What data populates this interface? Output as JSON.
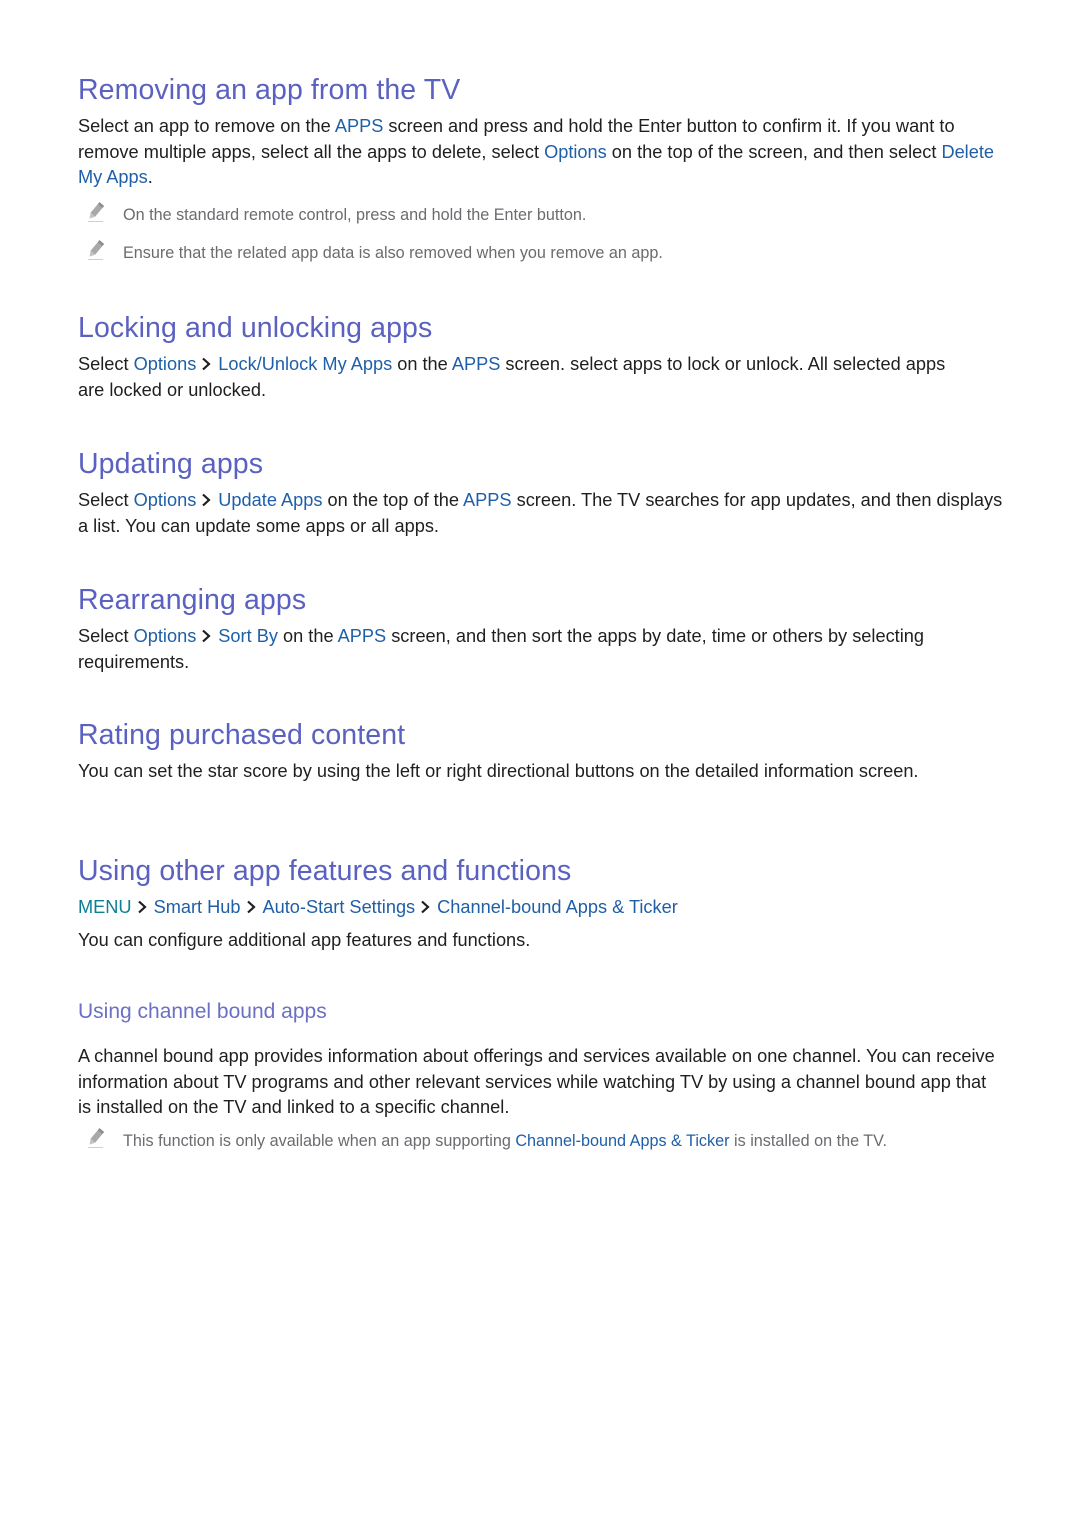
{
  "sections": {
    "removing": {
      "heading": "Removing an app from the TV",
      "body": {
        "t1": "Select an app to remove on the ",
        "l1": "APPS",
        "t2": " screen and press and hold the Enter button to confirm it. If you want to remove multiple apps, select all the apps to delete, select ",
        "l2": "Options",
        "t3": " on the top of the screen, and then select ",
        "l3": "Delete My Apps",
        "t4": "."
      },
      "notes": [
        "On the standard remote control, press and hold the Enter button.",
        "Ensure that the related app data is also removed when you remove an app."
      ]
    },
    "locking": {
      "heading": "Locking and unlocking apps",
      "body": {
        "t1": "Select ",
        "l1": "Options",
        "l2": "Lock/Unlock My Apps",
        "t2": " on the ",
        "l3": "APPS",
        "t3": " screen. select apps to lock or unlock. All selected apps are locked or unlocked."
      }
    },
    "updating": {
      "heading": "Updating apps",
      "body": {
        "t1": "Select ",
        "l1": "Options",
        "l2": "Update Apps",
        "t2": " on the top of the ",
        "l3": "APPS",
        "t3": " screen. The TV searches for app updates, and then displays a list. You can update some apps or all apps."
      }
    },
    "rearranging": {
      "heading": "Rearranging apps",
      "body": {
        "t1": "Select ",
        "l1": "Options",
        "l2": "Sort By",
        "t2": " on the ",
        "l3": "APPS",
        "t3": " screen, and then sort the apps by date, time or others by selecting requirements."
      }
    },
    "rating": {
      "heading": "Rating purchased content",
      "body": "You can set the star score by using the left or right directional buttons on the detailed information screen."
    },
    "other": {
      "heading": "Using other app features and functions",
      "menu_path": [
        "MENU",
        "Smart Hub",
        "Auto-Start Settings",
        "Channel-bound Apps & Ticker"
      ],
      "body": "You can configure additional app features and functions.",
      "subsection": {
        "heading": "Using channel bound apps",
        "body": "A channel bound app provides information about offerings and services available on one channel. You can receive information about TV programs and other relevant services while watching TV by using a channel bound app that is installed on the TV and linked to a specific channel.",
        "note": {
          "t1": "This function is only available when an app supporting ",
          "l1": "Channel-bound Apps & Ticker",
          "t2": " is installed on the TV."
        }
      }
    }
  },
  "icons": {
    "note": "pencil-icon",
    "path_separator": "chevron-right-icon"
  },
  "colors": {
    "heading": "#5b61c0",
    "subheading": "#6b70c4",
    "link": "#1f5fa8",
    "menu_link": "#0b7f93",
    "body_text": "#1f1f1f",
    "note_text": "#6b6b70"
  }
}
